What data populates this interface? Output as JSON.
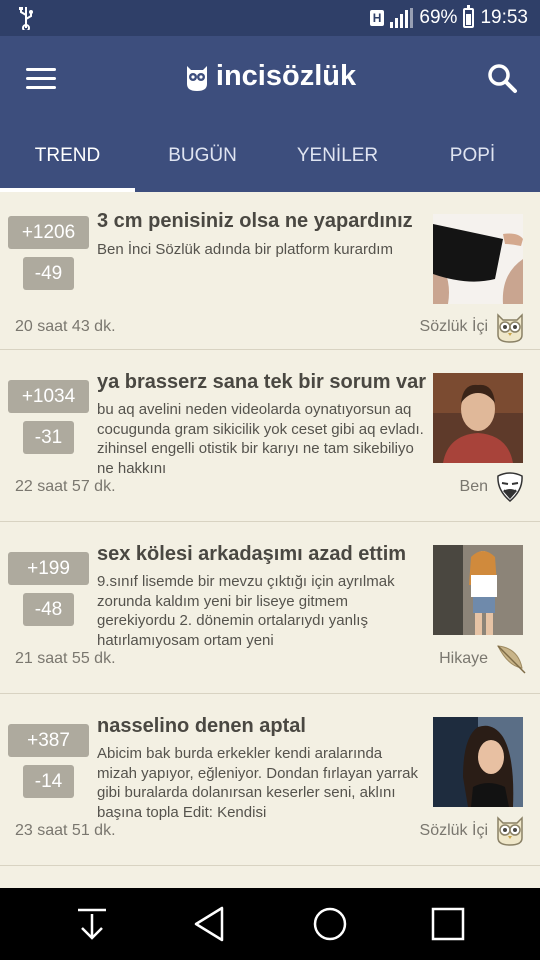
{
  "status_bar": {
    "battery": "69%",
    "time": "19:53",
    "network_label": "H"
  },
  "app": {
    "logo": "incisözlük"
  },
  "tabs": [
    {
      "label": "TREND",
      "active": true
    },
    {
      "label": "BUGÜN",
      "active": false
    },
    {
      "label": "YENİLER",
      "active": false
    },
    {
      "label": "POPİ",
      "active": false
    }
  ],
  "posts": [
    {
      "up": "+1206",
      "down": "-49",
      "title": "3 cm penisiniz olsa ne yapardınız",
      "excerpt": "Ben İnci Sözlük adında bir platform kurardım",
      "time": "20 saat 43 dk.",
      "category": "Sözlük İçi",
      "category_icon": "owl-icon"
    },
    {
      "up": "+1034",
      "down": "-31",
      "title": "ya brasserz sana tek bir sorum var",
      "excerpt": "bu aq avelini neden videolarda oynatıyorsun aq cocugunda gram sikicilik yok ceset gibi aq evladı. zihinsel engelli otistik bir karıyı ne tam sikebiliyo ne hakkını",
      "time": "22 saat 57 dk.",
      "category": "Ben",
      "category_icon": "mask-icon"
    },
    {
      "up": "+199",
      "down": "-48",
      "title": "sex kölesi arkadaşımı azad ettim",
      "excerpt": "9.sınıf lisemde bir mevzu çıktığı için ayrılmak zorunda kaldım yeni bir liseye gitmem gerekiyordu 2. dönemin ortalarıydı yanlış hatırlamıyosam ortam yeni",
      "time": "21 saat 55 dk.",
      "category": "Hikaye",
      "category_icon": "feather-icon"
    },
    {
      "up": "+387",
      "down": "-14",
      "title": "nasselino denen aptal",
      "excerpt": "Abicim bak burda erkekler kendi aralarında mizah yapıyor, eğleniyor. Dondan fırlayan yarrak gibi buralarda dolanırsan keserler seni, aklını başına topla Edit: Kendisi",
      "time": "23 saat 51 dk.",
      "category": "Sözlük İçi",
      "category_icon": "owl-icon"
    }
  ],
  "colors": {
    "header": "#3d4e7d",
    "status_bar": "#2f3f68",
    "background": "#f3f0e3",
    "vote_badge": "#aeaa9e"
  }
}
